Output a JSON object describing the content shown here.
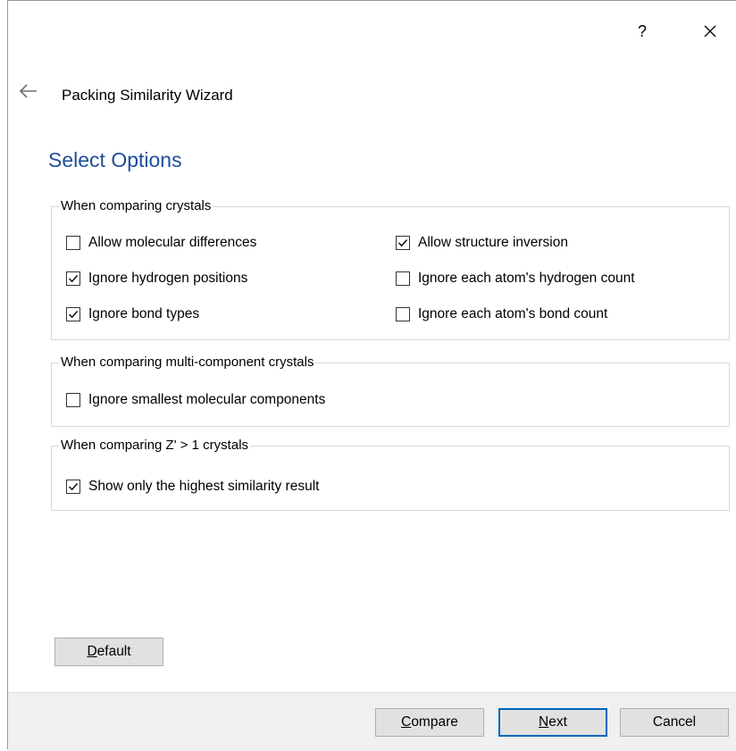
{
  "window": {
    "help_label": "?",
    "close_icon": "close-icon"
  },
  "header": {
    "back_icon": "back-arrow-icon",
    "wizard_title": "Packing Similarity Wizard"
  },
  "page": {
    "heading": "Select Options"
  },
  "groups": [
    {
      "legend": "When comparing crystals",
      "options": [
        {
          "label": "Allow molecular differences",
          "checked": false
        },
        {
          "label": "Allow structure inversion",
          "checked": true
        },
        {
          "label": "Ignore hydrogen positions",
          "checked": true
        },
        {
          "label": "Ignore each atom's hydrogen count",
          "checked": false
        },
        {
          "label": "Ignore bond types",
          "checked": true
        },
        {
          "label": "Ignore each atom's bond count",
          "checked": false
        }
      ]
    },
    {
      "legend": "When comparing multi-component crystals",
      "options": [
        {
          "label": "Ignore smallest molecular components",
          "checked": false
        }
      ]
    },
    {
      "legend": "When comparing Z' > 1 crystals",
      "options": [
        {
          "label": "Show only the highest similarity result",
          "checked": true
        }
      ]
    }
  ],
  "buttons": {
    "default": {
      "mnemonic": "D",
      "rest": "efault"
    },
    "compare": {
      "mnemonic": "C",
      "rest": "ompare"
    },
    "next": {
      "mnemonic": "N",
      "rest": "ext"
    },
    "cancel": {
      "label": "Cancel"
    }
  },
  "colors": {
    "heading": "#1f4e9c",
    "primary_button_border": "#0067c0",
    "footer_background": "#f0f0f0"
  }
}
